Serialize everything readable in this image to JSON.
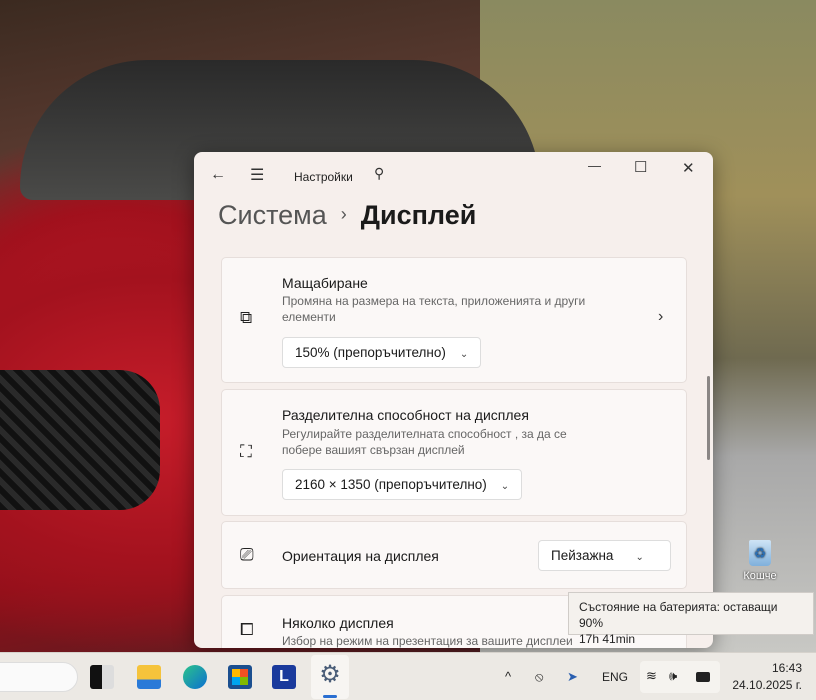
{
  "window": {
    "title": "Настройки",
    "minimize": "—",
    "maximize": "☐",
    "close": "✕"
  },
  "breadcrumb": {
    "parent": "Система",
    "separator": "›",
    "current": "Дисплей"
  },
  "cards": [
    {
      "title": "Мащабиране",
      "desc": "Промяна на размера на текста, приложенията и други елементи",
      "value": "150% (препоръчително)"
    },
    {
      "title": "Разделителна способност на дисплея",
      "desc": "Регулирайте разделителната способност , за да се побере вашият свързан дисплей",
      "value": "2160 × 1350 (препоръчително)"
    },
    {
      "title": "Ориентация на дисплея",
      "value": "Пейзажна"
    },
    {
      "title": "Няколко дисплея",
      "desc": "Избор на режим на презентация за вашите дисплеи"
    }
  ],
  "desktop": {
    "recycle_bin": "Кошче"
  },
  "tooltip": {
    "line1": "Състояние на батерията: оставащи 90%",
    "line2": "17h 41min"
  },
  "taskbar": {
    "language": "ENG",
    "time": "16:43",
    "date": "24.10.2025 г."
  }
}
